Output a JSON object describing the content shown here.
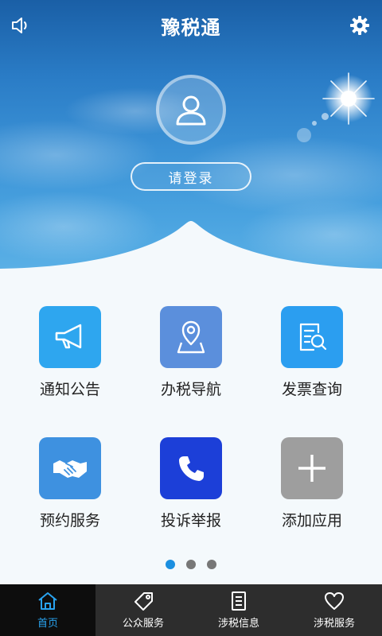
{
  "header": {
    "title": "豫税通",
    "login_label": "请登录"
  },
  "grid": {
    "items": [
      {
        "label": "通知公告",
        "icon": "megaphone-icon",
        "color": "#2ea6ef"
      },
      {
        "label": "办税导航",
        "icon": "map-pin-icon",
        "color": "#5b8fdc"
      },
      {
        "label": "发票查询",
        "icon": "invoice-search-icon",
        "color": "#2b9ef0"
      },
      {
        "label": "预约服务",
        "icon": "handshake-icon",
        "color": "#3e91e0"
      },
      {
        "label": "投诉举报",
        "icon": "phone-icon",
        "color": "#1c3fd8"
      },
      {
        "label": "添加应用",
        "icon": "plus-icon",
        "color": "#9e9e9e"
      }
    ]
  },
  "pager": {
    "count": 3,
    "active_index": 0,
    "active_color": "#1b8fe0",
    "inactive_color": "#777777"
  },
  "bottom_nav": {
    "items": [
      {
        "label": "首页",
        "icon": "home-icon",
        "active": true
      },
      {
        "label": "公众服务",
        "icon": "tag-icon",
        "active": false
      },
      {
        "label": "涉税信息",
        "icon": "document-icon",
        "active": false
      },
      {
        "label": "涉税服务",
        "icon": "heart-icon",
        "active": false
      }
    ],
    "active_color": "#29a3ef"
  }
}
